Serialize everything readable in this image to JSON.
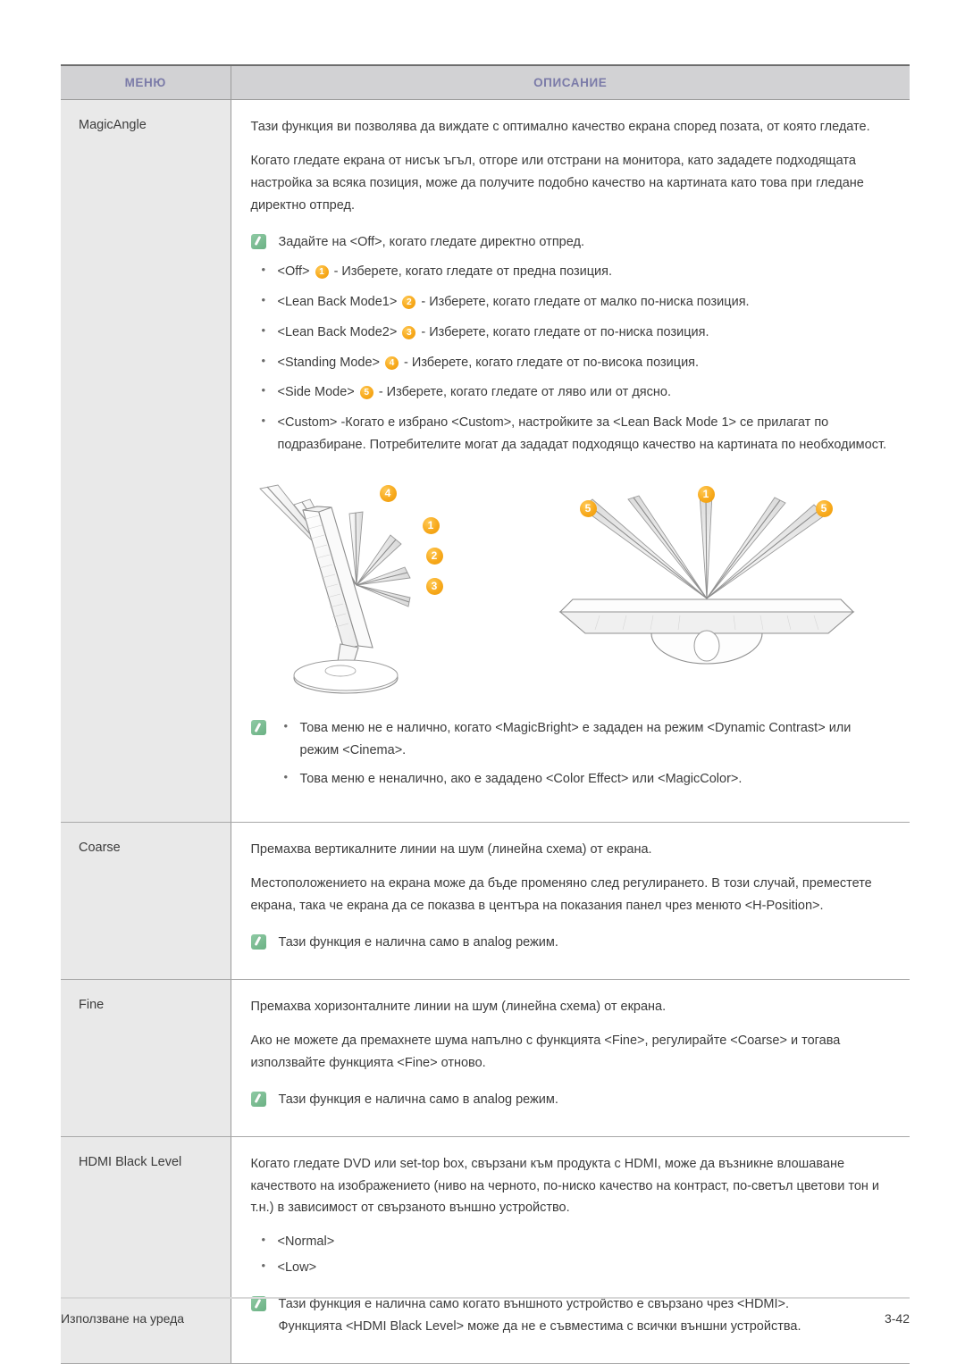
{
  "table": {
    "headers": {
      "menu": "МЕНЮ",
      "description": "ОПИСАНИЕ"
    },
    "rows": [
      {
        "menu": "MagicAngle",
        "paragraphs": [
          "Тази функция ви позволява да виждате с оптимално качество екрана според позата, от която гледате.",
          "Когато гледате екрана от нисък ъгъл, отгоре или отстрани на монитора, като зададете подходящата настройка за всяка позиция, може да получите подобно качество на картината като това при гледане директно отпред."
        ],
        "note_top": "Задайте на <Off>, когато гледате директно отпред.",
        "options": [
          {
            "label": "<Off>",
            "badge": "1",
            "text": "- Изберете, когато гледате от предна позиция."
          },
          {
            "label": "<Lean Back Mode1>",
            "badge": "2",
            "text": "- Изберете, когато гледате от малко по-ниска позиция."
          },
          {
            "label": "<Lean Back Mode2>",
            "badge": "3",
            "text": "- Изберете, когато гледате от по-ниска позиция."
          },
          {
            "label": "<Standing Mode>",
            "badge": "4",
            "text": "- Изберете, когато гледате от по-висока позиция."
          },
          {
            "label": "<Side Mode>",
            "badge": "5",
            "text": "- Изберете, когато гледате от ляво или от дясно."
          },
          {
            "label": "<Custom>",
            "badge": "",
            "text": "-Когато е избрано <Custom>, настройките за <Lean Back Mode 1> се прилагат по подразбиране. Потребителите могат да зададат подходящо качество на картината по необходимост."
          }
        ],
        "figure": {
          "left_labels": [
            "4",
            "1",
            "2",
            "3"
          ],
          "right_labels": [
            "5",
            "1",
            "5"
          ]
        },
        "note_bottom": [
          "Това меню не е налично, когато <MagicBright> е зададен на режим <Dynamic Contrast> или режим <Cinema>.",
          "Това меню е неналично, ако е зададено <Color Effect> или <MagicColor>."
        ]
      },
      {
        "menu": "Coarse",
        "paragraphs": [
          "Премахва вертикалните линии на шум (линейна схема) от екрана.",
          "Местоположението на екрана може да бъде променяно след регулирането. В този случай, преместете екрана, така че екрана да се показва в центъра на показания панел чрез менюто <H-Position>."
        ],
        "note": "Тази функция е налична само в analog режим."
      },
      {
        "menu": "Fine",
        "paragraphs": [
          "Премахва хоризонталните линии на шум (линейна схема) от екрана.",
          "Ако не можете да премахнете шума напълно с функцията <Fine>, регулирайте <Coarse> и тогава използвайте функцията <Fine> отново."
        ],
        "note": "Тази функция е налична само в analog режим."
      },
      {
        "menu": "HDMI Black Level",
        "paragraphs": [
          "Когато гледате DVD или set-top box, свързани към продукта с HDMI, може да възникне влошаване качеството на изображението (ниво на черното, по-ниско качество на контраст, по-светъл цветови тон и т.н.) в зависимост от свързаното външно устройство."
        ],
        "options": [
          {
            "label": "<Normal>",
            "badge": "",
            "text": ""
          },
          {
            "label": "<Low>",
            "badge": "",
            "text": ""
          }
        ],
        "note_lines": [
          "Тази функция е налична само когато външното устройство е свързано чрез <HDMI>.",
          "Функцията <HDMI Black Level> може да не е съвместима с всички външни устройства."
        ]
      }
    ]
  },
  "footer": {
    "left": "Използване на уреда",
    "right": "3-42"
  },
  "colors": {
    "header_text": "#7b7ba8",
    "header_bg": "#d2d2d4",
    "menu_cell_bg": "#e9e9e9",
    "badge": "#f7a81a",
    "note_icon": "#6bb184",
    "body_text": "#3c3c3c"
  },
  "icons": {
    "note": "pencil-note-icon"
  }
}
